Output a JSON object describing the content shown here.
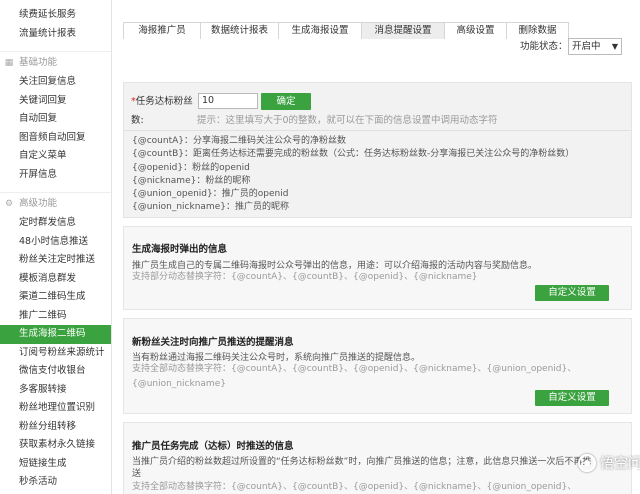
{
  "sidebar": {
    "items_top": [
      "续费延长服务",
      "流量统计报表"
    ],
    "group_basic": {
      "icon": "grid-icon",
      "label": "基础功能"
    },
    "items_basic": [
      "关注回复信息",
      "关键词回复",
      "自动回复",
      "图音频自动回复",
      "自定义菜单",
      "开屏信息"
    ],
    "group_advanced": {
      "icon": "settings-icon",
      "label": "高级功能"
    },
    "items_advanced": [
      "定时群发信息",
      "48小时信息推送",
      "粉丝关注定时推送",
      "模板消息群发",
      "渠道二维码生成",
      "推广二维码",
      "生成海报二维码",
      "订阅号粉丝来源统计",
      "微信支付收银台",
      "多客服转接",
      "粉丝地理位置识别",
      "粉丝分组转移",
      "获取素材永久链接",
      "短链接生成",
      "秒杀活动"
    ],
    "active_item": "生成海报二维码"
  },
  "tabs": [
    "海报推广员",
    "数据统计报表",
    "生成海报设置",
    "消息提醒设置",
    "高级设置",
    "删除数据"
  ],
  "active_tab": "消息提醒设置",
  "function_status": {
    "label": "功能状态：",
    "value": "开启中",
    "arrow": "▼"
  },
  "config": {
    "required_mark": "*",
    "threshold_label": "任务达标粉丝",
    "threshold_label_cont": "数:",
    "threshold_value": "10",
    "confirm_label": "确定",
    "hint": "提示：这里填写大于0的整数，就可以在下面的信息设置中调用动态字符",
    "variables": [
      "{@countA}：分享海报二维码关注公众号的净粉丝数",
      "{@countB}：距离任务达标还需要完成的粉丝数（公式：任务达标粉丝数-分享海报已关注公众号的净粉丝数）",
      "{@openid}：粉丝的openid",
      "{@nickname}：粉丝的昵称",
      "{@union_openid}：推广员的openid",
      "{@union_nickname}：推广员的昵称"
    ]
  },
  "panels": [
    {
      "title": "生成海报时弹出的信息",
      "desc": "推广员生成自己的专属二维码海报时公众号弹出的信息，用途：可以介绍海报的活动内容与奖励信息。",
      "support": [
        "支持部分动态替换字符：{@countA}、{@countB}、{@openid}、{@nickname}"
      ],
      "button": "自定义设置"
    },
    {
      "title": "新粉丝关注时向推广员推送的提醒消息",
      "desc": "当有粉丝通过海报二维码关注公众号时，系统向推广员推送的提醒信息。",
      "support": [
        "支持全部动态替换字符：{@countA}、{@countB}、{@openid}、{@nickname}、{@union_openid}、",
        "{@union_nickname}"
      ],
      "button": "自定义设置"
    },
    {
      "title": "推广员任务完成（达标）时推送的信息",
      "desc": "当推广员介绍的粉丝数超过所设置的“任务达标粉丝数”时，向推广员推送的信息；注意，此信息只推送一次后不再推",
      "desc_cont": "送",
      "support": [
        "支持全部动态替换字符：{@countA}、{@countB}、{@openid}、{@nickname}、{@union_openid}、"
      ]
    }
  ],
  "watermark": {
    "text": "悟空问答"
  }
}
